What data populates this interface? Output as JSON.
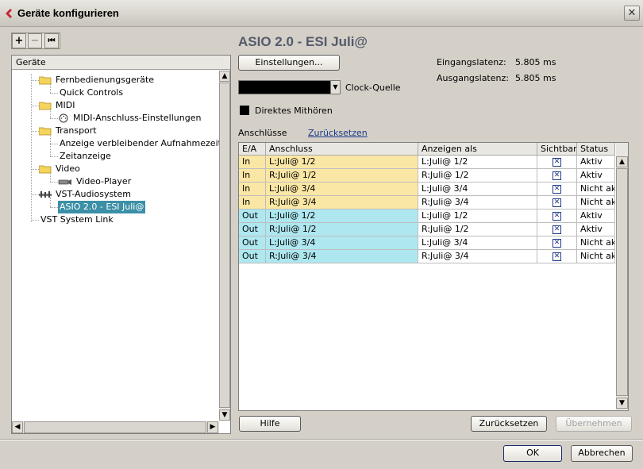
{
  "window": {
    "title": "Geräte konfigurieren",
    "close_glyph": "✕"
  },
  "toolbar": {
    "add": "+",
    "remove": "−",
    "reset": "⏮"
  },
  "tree": {
    "header": "Geräte",
    "items": [
      {
        "label": "Fernbedienungsgeräte",
        "icon": "folder-icon",
        "level": 0
      },
      {
        "label": "Quick Controls",
        "icon": "",
        "level": 1
      },
      {
        "label": "MIDI",
        "icon": "folder-icon",
        "level": 0
      },
      {
        "label": "MIDI-Anschluss-Einstellungen",
        "icon": "midi-port-icon",
        "level": 1
      },
      {
        "label": "Transport",
        "icon": "folder-icon",
        "level": 0
      },
      {
        "label": "Anzeige verbleibender Aufnahmezeit",
        "icon": "",
        "level": 1
      },
      {
        "label": "Zeitanzeige",
        "icon": "",
        "level": 1
      },
      {
        "label": "Video",
        "icon": "folder-icon",
        "level": 0
      },
      {
        "label": "Video-Player",
        "icon": "video-player-icon",
        "level": 1
      },
      {
        "label": "VST-Audiosystem",
        "icon": "audio-system-icon",
        "level": 0
      },
      {
        "label": "ASIO 2.0 - ESI Juli@",
        "icon": "",
        "level": 1,
        "selected": true
      },
      {
        "label": "VST System Link",
        "icon": "",
        "level": 0
      }
    ]
  },
  "device": {
    "title": "ASIO 2.0 - ESI Juli@",
    "settings_button": "Einstellungen...",
    "clock_source_label": "Clock-Quelle",
    "clock_source_value": "",
    "direct_monitoring_label": "Direktes Mithören",
    "direct_monitoring_checked": false,
    "input_latency_label": "Eingangslatenz:",
    "input_latency_value": "5.805 ms",
    "output_latency_label": "Ausgangslatenz:",
    "output_latency_value": "5.805 ms",
    "ports_label": "Anschlüsse",
    "reset_link": "Zurücksetzen"
  },
  "table": {
    "columns": [
      "E/A",
      "Anschluss",
      "Anzeigen als",
      "Sichtbar",
      "Status"
    ],
    "rows": [
      {
        "io": "In",
        "port": "L:Juli@ 1/2",
        "display": "L:Juli@ 1/2",
        "visible": "✕",
        "status": "Aktiv"
      },
      {
        "io": "In",
        "port": "R:Juli@ 1/2",
        "display": "R:Juli@ 1/2",
        "visible": "✕",
        "status": "Aktiv"
      },
      {
        "io": "In",
        "port": "L:Juli@ 3/4",
        "display": "L:Juli@ 3/4",
        "visible": "✕",
        "status": "Nicht aktiv"
      },
      {
        "io": "In",
        "port": "R:Juli@ 3/4",
        "display": "R:Juli@ 3/4",
        "visible": "✕",
        "status": "Nicht aktiv"
      },
      {
        "io": "Out",
        "port": "L:Juli@ 1/2",
        "display": "L:Juli@ 1/2",
        "visible": "✕",
        "status": "Aktiv"
      },
      {
        "io": "Out",
        "port": "R:Juli@ 1/2",
        "display": "R:Juli@ 1/2",
        "visible": "✕",
        "status": "Aktiv"
      },
      {
        "io": "Out",
        "port": "L:Juli@ 3/4",
        "display": "L:Juli@ 3/4",
        "visible": "✕",
        "status": "Nicht aktiv"
      },
      {
        "io": "Out",
        "port": "R:Juli@ 3/4",
        "display": "R:Juli@ 3/4",
        "visible": "✕",
        "status": "Nicht aktiv"
      }
    ]
  },
  "buttons": {
    "help": "Hilfe",
    "reset": "Zurücksetzen",
    "apply": "Übernehmen",
    "ok": "OK",
    "cancel": "Abbrechen"
  },
  "colors": {
    "in_row": "#fbe7a5",
    "out_row": "#aee7f0",
    "selection": "#3b8fa6"
  }
}
